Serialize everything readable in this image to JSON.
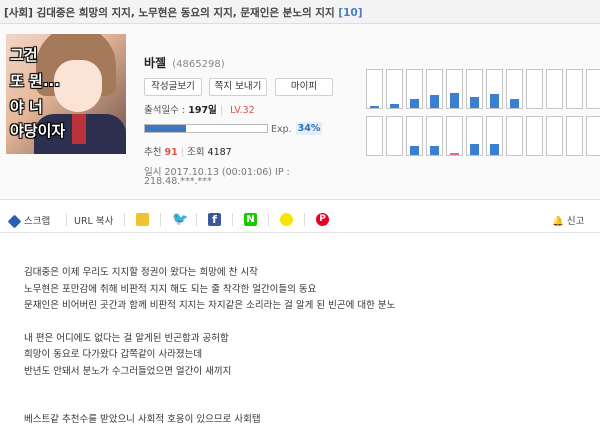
{
  "post": {
    "category": "[사회]",
    "title": "김대중은 희망의 지지, 노무현은 동요의 지지, 문재인은 분노의 지지",
    "comment_count": "[10]"
  },
  "profile": {
    "avatar_caption": [
      "그건",
      "또 뭔...",
      "야 너",
      "야당이자"
    ],
    "nickname": "바젤",
    "user_id": "(4865298)",
    "buttons": {
      "posts": "작성글보기",
      "message": "쪽지 보내기",
      "mypi": "마이피"
    },
    "attendance_label": "출석일수 :",
    "attendance_value": "197일",
    "level": "LV.32",
    "exp_label": "Exp.",
    "exp_percent": "34%",
    "exp_fraction": 0.34,
    "recommend_label": "추천",
    "recommend_value": "91",
    "views_label": "조회",
    "views_value": "4187",
    "date": "일시 2017.10.13 (00:01:06)  IP :",
    "ip": "218.48.***.***"
  },
  "activity_graph": {
    "row1": [
      0.05,
      0.1,
      0.25,
      0.35,
      0.4,
      0.3,
      0.38,
      0.25,
      0.0,
      0.0,
      0.0,
      0.0
    ],
    "row2": [
      0.0,
      0.0,
      0.25,
      0.25,
      0.05,
      0.3,
      0.3,
      0.0,
      0.0,
      0.0,
      0.0,
      0.0
    ],
    "row2_pink_index": 4,
    "bar_color": "#3a7fd1",
    "pink_color": "#e06a9a"
  },
  "share": {
    "scrap": "스크랩",
    "url_copy": "URL 복사",
    "report": "신고",
    "icons": [
      "kakaostory-icon",
      "twitter-icon",
      "facebook-icon",
      "naver-icon",
      "kakaotalk-icon",
      "pinterest-icon"
    ]
  },
  "content": {
    "lines": [
      "김대중은 이제 우리도 지지할 정권이 왔다는 희망에 찬 시작",
      "노무현은 포만감에 취해 비판적 지지 해도 되는 줄 착각한 얼간이들의 동요",
      "문재인은 비어버린 곳간과 함께 비판적 지지는 자지같은 소리라는 걸 알게 된 빈곤에 대한 분노",
      "",
      "내 편은 어디에도 없다는 걸 알게된 빈곤함과 공허함",
      "희망이 동요로 다가왔다 갑쪽같이 사라졌는데",
      "반년도 안돼서 분노가 수그러들었으면 얼간이 새끼지",
      "",
      "",
      "베스트같 추천수를 받았으니 사회적 호응이 있으므로 사회탭"
    ]
  }
}
